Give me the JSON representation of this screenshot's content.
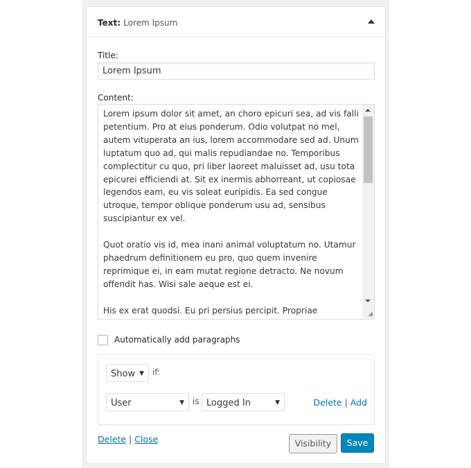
{
  "widget": {
    "type_label": "Text:",
    "title": "Lorem Ipsum"
  },
  "form": {
    "title_label": "Title:",
    "title_value": "Lorem Ipsum",
    "content_label": "Content:",
    "content_value": "Lorem ipsum dolor sit amet, an choro epicuri sea, ad vis falli petentium. Pro at eius ponderum. Odio volutpat no mel, autem vituperata an ius, lorem accommodare sed ad. Unum luptatum quo ad, qui malis repudiandae no. Temporibus complectitur cu quo, pri liber laoreet maluisset ad, usu tota epicurei efficiendi at. Sit ex inermis abhorreant, ut copiosae legendos eam, eu vis soleat euripidis. Ea sed congue utroque, tempor oblique ponderum usu ad, sensibus suscipiantur ex vel.\n\nQuot oratio vis id, mea inani animal voluptatum no. Utamur phaedrum definitionem eu pro, quo quem invenire reprimique ei, in eam mutat regione detracto. Ne novum offendit has. Wisi sale aeque est ei.\n\nHis ex erat quodsi. Eu pri persius percipit. Propriae",
    "auto_paragraphs_label": "Automatically add paragraphs",
    "auto_paragraphs_checked": false
  },
  "visibility": {
    "action": "Show",
    "if_label": "if:",
    "rule_subject": "User",
    "is_label": "is",
    "rule_value": "Logged In",
    "delete": "Delete",
    "separator": "|",
    "add": "Add"
  },
  "footer": {
    "delete": "Delete",
    "separator": "|",
    "close": "Close",
    "visibility": "Visibility",
    "save": "Save"
  },
  "colors": {
    "link": "#0073aa",
    "primary": "#0085ba"
  }
}
